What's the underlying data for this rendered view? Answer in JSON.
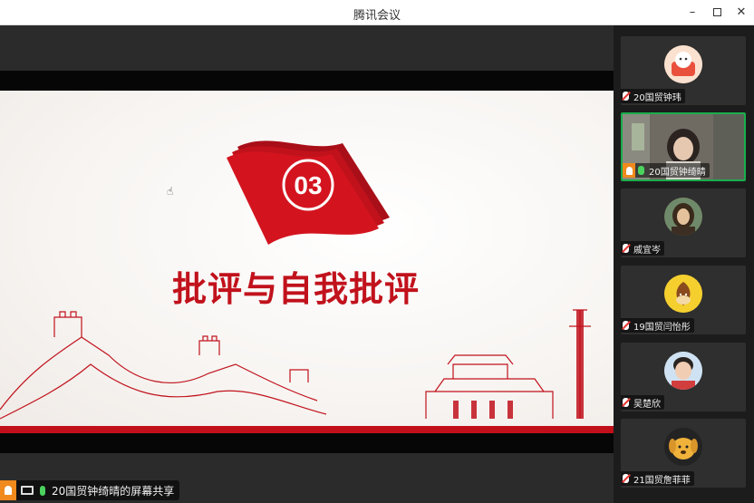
{
  "window": {
    "title": "腾讯会议"
  },
  "slide": {
    "badge_number": "03",
    "heading": "批评与自我批评"
  },
  "share_bar": {
    "text": "20国贸钟绮晴的屏幕共享"
  },
  "participants": [
    {
      "name": "20国贸钟玮",
      "mic": "muted",
      "avatar": "cartoon-cat-avatar"
    },
    {
      "name": "20国贸钟绮晴",
      "mic": "on",
      "host": true,
      "avatar": "camera-video"
    },
    {
      "name": "戚宜岑",
      "mic": "muted",
      "avatar": "painting-portrait-avatar"
    },
    {
      "name": "19国贸闫怡彤",
      "mic": "muted",
      "avatar": "chestnut-emoji-avatar"
    },
    {
      "name": "吴楚欣",
      "mic": "muted",
      "avatar": "child-photo-avatar"
    },
    {
      "name": "21国贸詹菲菲",
      "mic": "muted",
      "avatar": "yellow-dog-avatar"
    }
  ],
  "colors": {
    "accent_red": "#c1121c",
    "active_border": "#1aad4b",
    "host_orange": "#f08a1c"
  }
}
